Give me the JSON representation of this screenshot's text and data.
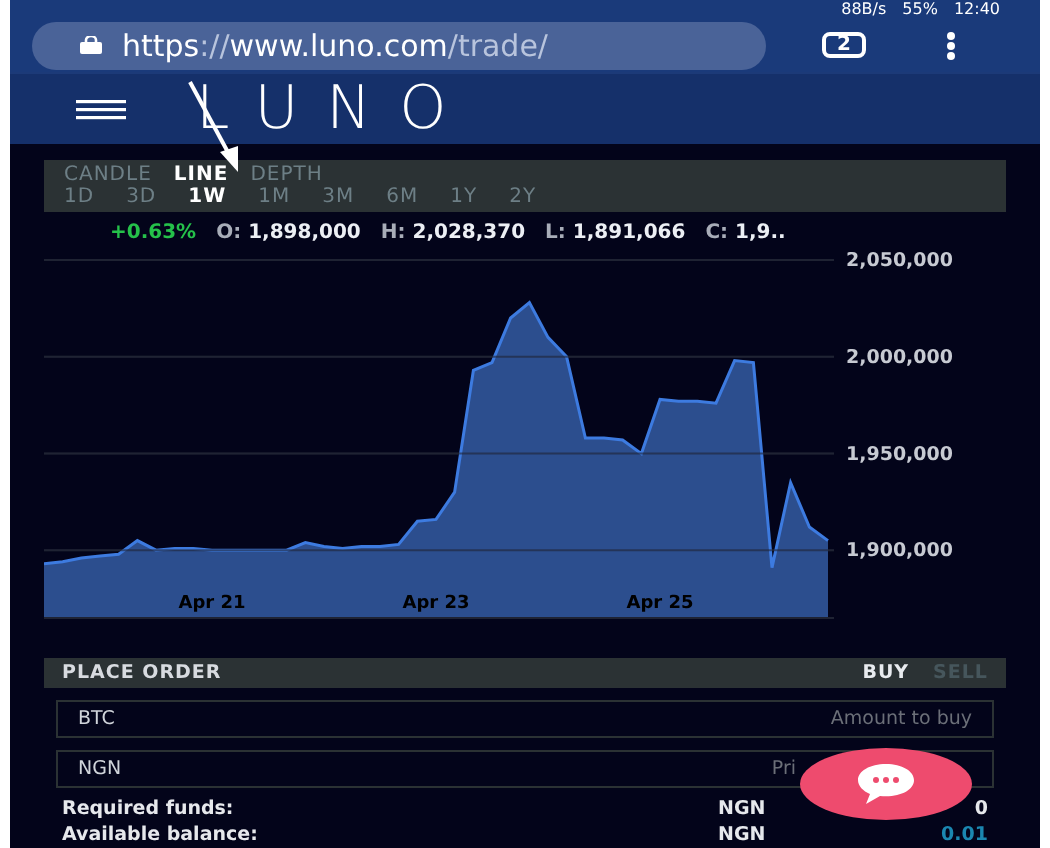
{
  "status_bar": {
    "network_speed": "88B/s",
    "battery": "55%",
    "time": "12:40"
  },
  "browser": {
    "url_host": "https://www.luno.com",
    "url_path": "/trade/",
    "tab_count": "2"
  },
  "header": {
    "logo": "LUNO"
  },
  "chart_types": [
    {
      "label": "CANDLE",
      "selected": false
    },
    {
      "label": "LINE",
      "selected": true
    },
    {
      "label": "DEPTH",
      "selected": false
    }
  ],
  "ranges": [
    {
      "label": "1D",
      "selected": false
    },
    {
      "label": "3D",
      "selected": false
    },
    {
      "label": "1W",
      "selected": true
    },
    {
      "label": "1M",
      "selected": false
    },
    {
      "label": "3M",
      "selected": false
    },
    {
      "label": "6M",
      "selected": false
    },
    {
      "label": "1Y",
      "selected": false
    },
    {
      "label": "2Y",
      "selected": false
    }
  ],
  "stats": [
    {
      "kind": "change",
      "text": "+0.63%"
    },
    {
      "kind": "ohlc",
      "label": "O:",
      "value": "1,898,000"
    },
    {
      "kind": "ohlc",
      "label": "H:",
      "value": "2,028,370"
    },
    {
      "kind": "ohlc",
      "label": "L:",
      "value": "1,891,066"
    },
    {
      "kind": "ohlc",
      "label": "C:",
      "value": "1,9.."
    }
  ],
  "chart_data": {
    "type": "area",
    "categories": [
      null,
      null,
      null,
      null,
      null,
      null,
      null,
      null,
      null,
      "Apr 21",
      null,
      null,
      null,
      null,
      null,
      null,
      null,
      null,
      null,
      null,
      null,
      "Apr 23",
      null,
      null,
      null,
      null,
      null,
      null,
      null,
      null,
      null,
      null,
      null,
      "Apr 25",
      null,
      null,
      null,
      null,
      null,
      null,
      null,
      null,
      null
    ],
    "series": [
      {
        "color": "#3d7be0",
        "values": [
          1893000,
          1894000,
          1896000,
          1897000,
          1898000,
          1905000,
          1900000,
          1901000,
          1901000,
          1900000,
          1900000,
          1900000,
          1900000,
          1900000,
          1904000,
          1902000,
          1901000,
          1902000,
          1902000,
          1903000,
          1915000,
          1916000,
          1930000,
          1993000,
          1997000,
          2020000,
          2028000,
          2010000,
          2000000,
          1958000,
          1958000,
          1957000,
          1950000,
          1978000,
          1977000,
          1977000,
          1976000,
          1998000,
          1997000,
          1891000,
          1935000,
          1912000,
          1905000
        ]
      }
    ],
    "grid": true,
    "ylim": [
      1865000,
      2050000
    ],
    "yticks": [
      {
        "value": 1900000,
        "label": "1,900,000"
      },
      {
        "value": 1950000,
        "label": "1,950,000"
      },
      {
        "value": 2000000,
        "label": "2,000,000"
      },
      {
        "value": 2050000,
        "label": "2,050,000"
      }
    ]
  },
  "order": {
    "title": "PLACE ORDER",
    "sides": [
      {
        "label": "BUY",
        "selected": true
      },
      {
        "label": "SELL",
        "selected": false
      }
    ],
    "fields": [
      {
        "label": "BTC",
        "placeholder": "Amount to buy"
      },
      {
        "label": "NGN",
        "placeholder": "Pri"
      }
    ],
    "summary": [
      {
        "label": "Required funds:",
        "currency": "NGN",
        "value": "0",
        "kind": "plain"
      },
      {
        "label": "Available balance:",
        "currency": "NGN",
        "value": "0.01",
        "kind": "accent"
      }
    ]
  }
}
